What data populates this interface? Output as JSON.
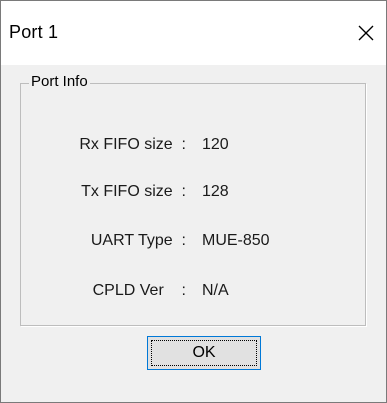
{
  "window": {
    "title": "Port 1",
    "close_icon": "close-icon"
  },
  "port_info": {
    "legend": "Port Info",
    "rows": [
      {
        "label": "Rx FIFO size  :",
        "value": "120"
      },
      {
        "label": "Tx FIFO size  :",
        "value": "128"
      },
      {
        "label": "UART Type  :",
        "value": "MUE-850"
      },
      {
        "label": "CPLD Ver    :",
        "value": "N/A"
      }
    ]
  },
  "actions": {
    "ok_label": "OK"
  },
  "colors": {
    "dialog_background": "#f0f0f0",
    "titlebar_background": "#ffffff",
    "button_focus_border": "#0078d7"
  }
}
